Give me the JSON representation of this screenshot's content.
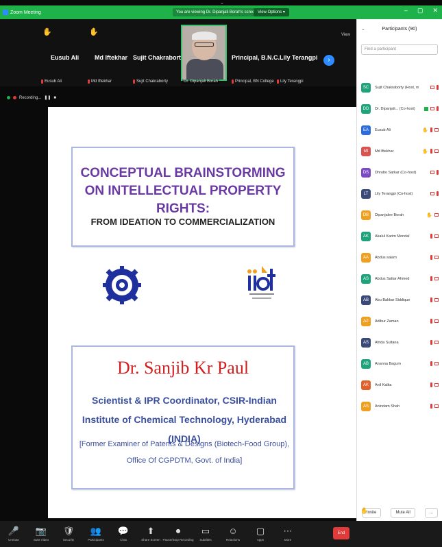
{
  "titlebar": {
    "app_title": "Zoom Meeting",
    "viewing_text": "You are viewing Dr. Dipanjali Borah's screen",
    "view_options": "View Options ▾",
    "win_min": "–",
    "win_max": "▢",
    "win_close": "✕"
  },
  "strip": {
    "tiles": [
      {
        "name": "Eusub Ali",
        "sub": "Eusub Ali"
      },
      {
        "name": "Md Iftekhar",
        "sub": "Md Iftekhar"
      },
      {
        "name": "Sujit Chakraborty",
        "sub": "Sujit Chakraborty"
      },
      {
        "name": "",
        "sub": "Dr. Dipanjali Borah"
      },
      {
        "name": "Principal, B.N.C...",
        "sub": "Principal, BN College"
      },
      {
        "name": "Lily Terangpi",
        "sub": "Lily Terangpi"
      }
    ],
    "gallery_label": "View",
    "next_glyph": "›"
  },
  "recording": {
    "label": "Recording..."
  },
  "slide": {
    "title": "CONCEPTUAL BRAINSTORMING ON INTELLECTUAL PROPERTY RIGHTS:",
    "subtitle": "FROM IDEATION TO COMMERCIALIZATION",
    "speaker": "Dr. Sanjib Kr Paul",
    "role": "Scientist & IPR Coordinator, CSIR-Indian Institute of Chemical Technology, Hyderabad (INDIA)",
    "former": "[Former Examiner of Patents & Designs (Biotech-Food Group), Office Of CGPDTM, Govt. of India]"
  },
  "panel": {
    "title": "Participants (90)",
    "search_placeholder": "Find a participant",
    "participants": [
      {
        "initials": "SC",
        "name": "Sujit Chakraborty (Host, me)",
        "color": "#1fa37a"
      },
      {
        "initials": "DD",
        "name": "Dr. Dipanjali... (Co-host)",
        "color": "#1fa37a"
      },
      {
        "initials": "EA",
        "name": "Eusub Ali",
        "color": "#2d6cdf"
      },
      {
        "initials": "MI",
        "name": "Md Iftekhar",
        "color": "#d9534f"
      },
      {
        "initials": "DS",
        "name": "Dhrubo Sarkar (Co-host)",
        "color": "#7b4bc4"
      },
      {
        "initials": "LT",
        "name": "Lily Terangpi (Co-host)",
        "color": "#3a4a78"
      },
      {
        "initials": "DB",
        "name": "Dipanjalee Borah",
        "color": "#f0a020"
      },
      {
        "initials": "AK",
        "name": "Akalul Karim Mondal",
        "color": "#1fa37a"
      },
      {
        "initials": "AA",
        "name": "Abdus salam",
        "color": "#f0a020"
      },
      {
        "initials": "AS",
        "name": "Abdus Sattar Ahmed",
        "color": "#1fa37a"
      },
      {
        "initials": "AB",
        "name": "Abu Bakkar Siddique",
        "color": "#3a4a78"
      },
      {
        "initials": "AZ",
        "name": "Adibur Zaman",
        "color": "#f0a020"
      },
      {
        "initials": "AS",
        "name": "Afrida Sultana",
        "color": "#3a4a78"
      },
      {
        "initials": "AB",
        "name": "Ananna Bagum",
        "color": "#1fa37a"
      },
      {
        "initials": "AK",
        "name": "Anil Kalita",
        "color": "#e0602a"
      },
      {
        "initials": "AS",
        "name": "Anindam Shah",
        "color": "#f0a020"
      }
    ],
    "invite": "Invite",
    "mute_all": "Mute All",
    "more": "..."
  },
  "toolbar": {
    "buttons": [
      {
        "glyph": "🎤",
        "label": "Unmute"
      },
      {
        "glyph": "📷",
        "label": "Start Video"
      },
      {
        "glyph": "🛡",
        "label": "Security"
      },
      {
        "glyph": "👥",
        "label": "Participants"
      },
      {
        "glyph": "💬",
        "label": "Chat"
      },
      {
        "glyph": "⬆",
        "label": "Share Screen"
      },
      {
        "glyph": "⏺",
        "label": "Pause/Stop Recording"
      },
      {
        "glyph": "▭",
        "label": "Subtitles"
      },
      {
        "glyph": "☺",
        "label": "Reactions"
      },
      {
        "glyph": "▢",
        "label": "Apps"
      },
      {
        "glyph": "⋯",
        "label": "More"
      }
    ],
    "end": "End"
  },
  "colors": {
    "zoom_green": "#1fb14a",
    "zoom_blue": "#2d8cff",
    "end_red": "#e03a3a",
    "slide_title": "#6a3aa3",
    "speaker": "#d21f1f",
    "role_blue": "#3b4fa0"
  },
  "icons": [
    "zoom-logo-icon",
    "hand-raised-icon",
    "mic-muted-icon",
    "chevron-right-icon",
    "recording-dot-icon",
    "search-icon"
  ]
}
